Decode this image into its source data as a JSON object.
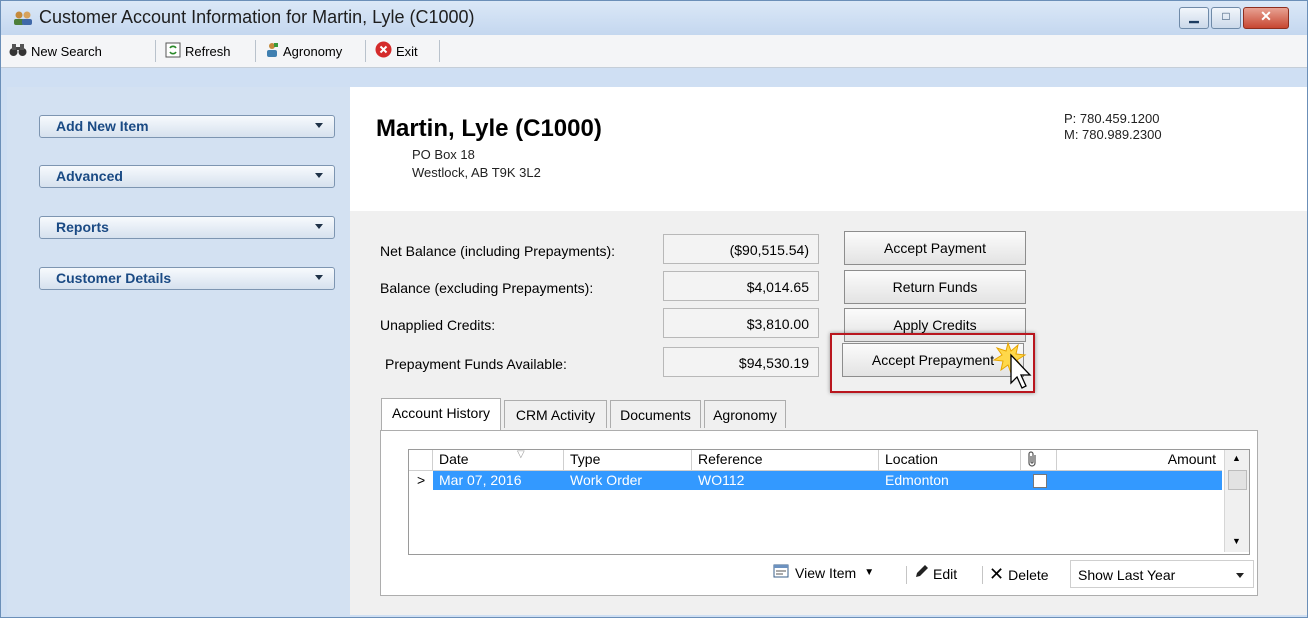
{
  "window": {
    "title": "Customer Account Information for Martin, Lyle (C1000)"
  },
  "toolbar": {
    "new_search": "New Search",
    "refresh": "Refresh",
    "agronomy": "Agronomy",
    "exit": "Exit"
  },
  "sidebar": {
    "items": [
      {
        "label": "Add New Item"
      },
      {
        "label": "Advanced"
      },
      {
        "label": "Reports"
      },
      {
        "label": "Customer Details"
      }
    ]
  },
  "customer": {
    "name": "Martin, Lyle (C1000)",
    "address_line1": "PO Box 18",
    "address_line2": "Westlock, AB  T9K 3L2",
    "phone_p": "P:  780.459.1200",
    "phone_m": "M:  780.989.2300"
  },
  "balances": [
    {
      "label": "Net Balance (including Prepayments):",
      "value": "($90,515.54)"
    },
    {
      "label": "Balance (excluding Prepayments):",
      "value": "$4,014.65"
    },
    {
      "label": "Unapplied Credits:",
      "value": "$3,810.00"
    },
    {
      "label": "Prepayment Funds Available:",
      "value": "$94,530.19"
    }
  ],
  "actions": {
    "accept_payment": "Accept Payment",
    "return_funds": "Return Funds",
    "apply_credits": "Apply Credits",
    "accept_prepayment": "Accept Prepayment"
  },
  "tabs": [
    {
      "label": "Account History"
    },
    {
      "label": "CRM Activity"
    },
    {
      "label": "Documents"
    },
    {
      "label": "Agronomy"
    }
  ],
  "grid": {
    "columns": [
      "Date",
      "Type",
      "Reference",
      "Location",
      "",
      "Amount"
    ],
    "rows": [
      {
        "marker": ">",
        "date": "Mar 07, 2016",
        "type": "Work Order",
        "reference": "WO112",
        "location": "Edmonton",
        "amount": ""
      }
    ]
  },
  "bottom": {
    "view_item": "View Item",
    "edit": "Edit",
    "delete": "Delete",
    "filter": "Show Last Year"
  },
  "colors": {
    "selection": "#3399ff",
    "highlight_border": "#b9161e",
    "sidebar_text": "#1a4a84"
  }
}
